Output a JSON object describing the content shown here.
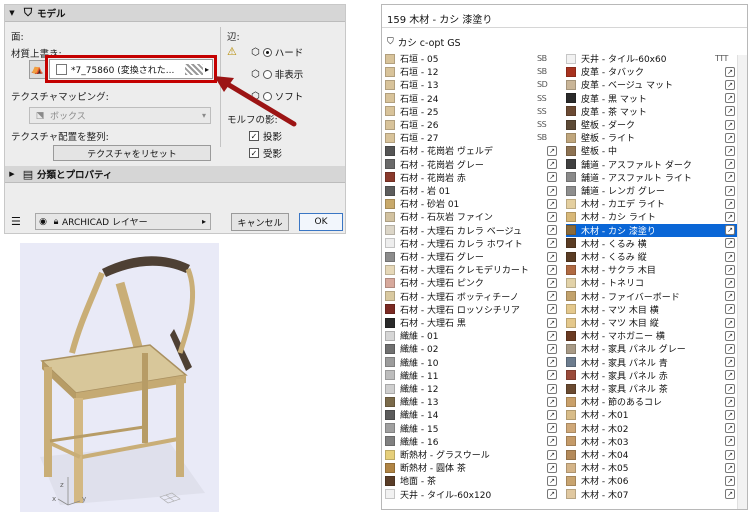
{
  "dialog": {
    "model_section": "モデル",
    "surface_label": "面:",
    "material_override_label": "材質上書き:",
    "material_value": "*7_75860 (変換された...",
    "texture_mapping_label": "テクスチャマッピング:",
    "mapping_value": "ボックス",
    "texture_align_label": "テクスチャ配置を整列:",
    "reset_texture_button": "テクスチャをリセット",
    "edge_label": "辺:",
    "edge_options": [
      "ハード",
      "非表示",
      "ソフト"
    ],
    "morph_shadow_label": "モルフの影:",
    "cast_shadow": "投影",
    "receive_shadow": "受影",
    "classification_section": "分類とプロパティ",
    "layer_value": "ARCHICAD レイヤー",
    "cancel_button": "キャンセル",
    "ok_button": "OK"
  },
  "viewport": {
    "axes": [
      "z",
      "y",
      "x"
    ]
  },
  "panel": {
    "title": "159 木材 - カシ 漆塗り",
    "library": "カシ c-opt GS",
    "left_column": [
      {
        "label": "石垣 - 05",
        "color": "#d8c39a"
      },
      {
        "label": "石垣 - 12",
        "color": "#d8c39a"
      },
      {
        "label": "石垣 - 13",
        "color": "#d8c39a"
      },
      {
        "label": "石垣 - 24",
        "color": "#d8c39a"
      },
      {
        "label": "石垣 - 25",
        "color": "#d8c39a"
      },
      {
        "label": "石垣 - 26",
        "color": "#d8c39a"
      },
      {
        "label": "石垣 - 27",
        "color": "#d8c39a"
      },
      {
        "label": "石材 - 花崗岩 ヴェルデ",
        "color": "#555555"
      },
      {
        "label": "石材 - 花崗岩 グレー",
        "color": "#6a6a6a"
      },
      {
        "label": "石材 - 花崗岩 赤",
        "color": "#8a3a2c"
      },
      {
        "label": "石材 - 岩 01",
        "color": "#5d5d5d"
      },
      {
        "label": "石材 - 砂岩 01",
        "color": "#c8a96b"
      },
      {
        "label": "石材 - 石灰岩 ファイン",
        "color": "#d2c2a0"
      },
      {
        "label": "石材 - 大理石 カレラ ベージュ",
        "color": "#dcd6c8"
      },
      {
        "label": "石材 - 大理石 カレラ ホワイト",
        "color": "#eeeeee"
      },
      {
        "label": "石材 - 大理石 グレー",
        "color": "#8c8c8c"
      },
      {
        "label": "石材 - 大理石 クレモデリカート",
        "color": "#e6d8b8"
      },
      {
        "label": "石材 - 大理石 ピンク",
        "color": "#d7a99c"
      },
      {
        "label": "石材 - 大理石 ボッティチーノ",
        "color": "#d9c9a0"
      },
      {
        "label": "石材 - 大理石 ロッソシチリア",
        "color": "#7b2a23"
      },
      {
        "label": "石材 - 大理石 黒",
        "color": "#2a2a2a"
      },
      {
        "label": "織維 - 01",
        "color": "#d6d6d6"
      },
      {
        "label": "織維 - 02",
        "color": "#707070"
      },
      {
        "label": "織維 - 10",
        "color": "#9c9c9c"
      },
      {
        "label": "織維 - 11",
        "color": "#bdbdbd"
      },
      {
        "label": "織維 - 12",
        "color": "#cfcfcf"
      },
      {
        "label": "織維 - 13",
        "color": "#7a6a4a"
      },
      {
        "label": "織維 - 14",
        "color": "#5b5b5b"
      },
      {
        "label": "織維 - 15",
        "color": "#a0a0a0"
      },
      {
        "label": "織維 - 16",
        "color": "#808080"
      },
      {
        "label": "断熱材 - グラスウール",
        "color": "#e6cf7a"
      },
      {
        "label": "断熱材 - 圓体 茶",
        "color": "#b08444"
      },
      {
        "label": "地面 - 茶",
        "color": "#5a3d28"
      },
      {
        "label": "天井 - タイル-60x120",
        "color": "#f2f2f2"
      }
    ],
    "right_column": [
      {
        "label": "天井 - タイル-60x60",
        "color": "#f2f2f2"
      },
      {
        "label": "皮革 - タバック",
        "color": "#a8321f"
      },
      {
        "label": "皮革 - ベージュ マット",
        "color": "#c9b597"
      },
      {
        "label": "皮革 - 黒 マット",
        "color": "#2a2a2a"
      },
      {
        "label": "皮革 - 茶 マット",
        "color": "#6b4a33"
      },
      {
        "label": "壁板 - ダーク",
        "color": "#5d4a36"
      },
      {
        "label": "壁板 - ライト",
        "color": "#c0a67c"
      },
      {
        "label": "壁板 - 中",
        "color": "#8d7252"
      },
      {
        "label": "舗道 - アスファルト ダーク",
        "color": "#404040"
      },
      {
        "label": "舗道 - アスファルト ライト",
        "color": "#8a8a8a"
      },
      {
        "label": "舗道 - レンガ グレー",
        "color": "#8e8e8e"
      },
      {
        "label": "木材 - カエデ ライト",
        "color": "#e4cf9f"
      },
      {
        "label": "木材 - カシ ライト",
        "color": "#d8b878"
      },
      {
        "label": "木材 - カシ 漆塗り",
        "color": "#8a6b3c"
      },
      {
        "label": "木材 - くるみ 横",
        "color": "#5a3c24"
      },
      {
        "label": "木材 - くるみ 縦",
        "color": "#5a3c24"
      },
      {
        "label": "木材 - サクラ 木目",
        "color": "#b06a42"
      },
      {
        "label": "木材 - トネリコ",
        "color": "#e2d2a8"
      },
      {
        "label": "木材 - ファイバーボード",
        "color": "#c2a26c"
      },
      {
        "label": "木材 - マツ 木目 横",
        "color": "#e4c88c"
      },
      {
        "label": "木材 - マツ 木目 縦",
        "color": "#e4c88c"
      },
      {
        "label": "木材 - マホガニー 横",
        "color": "#6a3a22"
      },
      {
        "label": "木材 - 家具 パネル グレー",
        "color": "#a89a86"
      },
      {
        "label": "木材 - 家具 パネル 青",
        "color": "#6c7c8e"
      },
      {
        "label": "木材 - 家具 パネル 赤",
        "color": "#9a4a3a"
      },
      {
        "label": "木材 - 家具 パネル 茶",
        "color": "#6a4a30"
      },
      {
        "label": "木材 - 節のあるコレ",
        "color": "#c9a06a"
      },
      {
        "label": "木材 - 木01",
        "color": "#d8bc88"
      },
      {
        "label": "木材 - 木02",
        "color": "#cfa878"
      },
      {
        "label": "木材 - 木03",
        "color": "#c49a68"
      },
      {
        "label": "木材 - 木04",
        "color": "#b48a5a"
      },
      {
        "label": "木材 - 木05",
        "color": "#d4b488"
      },
      {
        "label": "木材 - 木06",
        "color": "#c8a470"
      },
      {
        "label": "木材 - 木07",
        "color": "#e0c8a0"
      }
    ],
    "selected_index_right": 13,
    "icon_text_left": [
      "SB",
      "SB",
      "SD",
      "SS",
      "SS",
      "SS",
      "SB"
    ],
    "icon_text_right_first": "TTT"
  }
}
